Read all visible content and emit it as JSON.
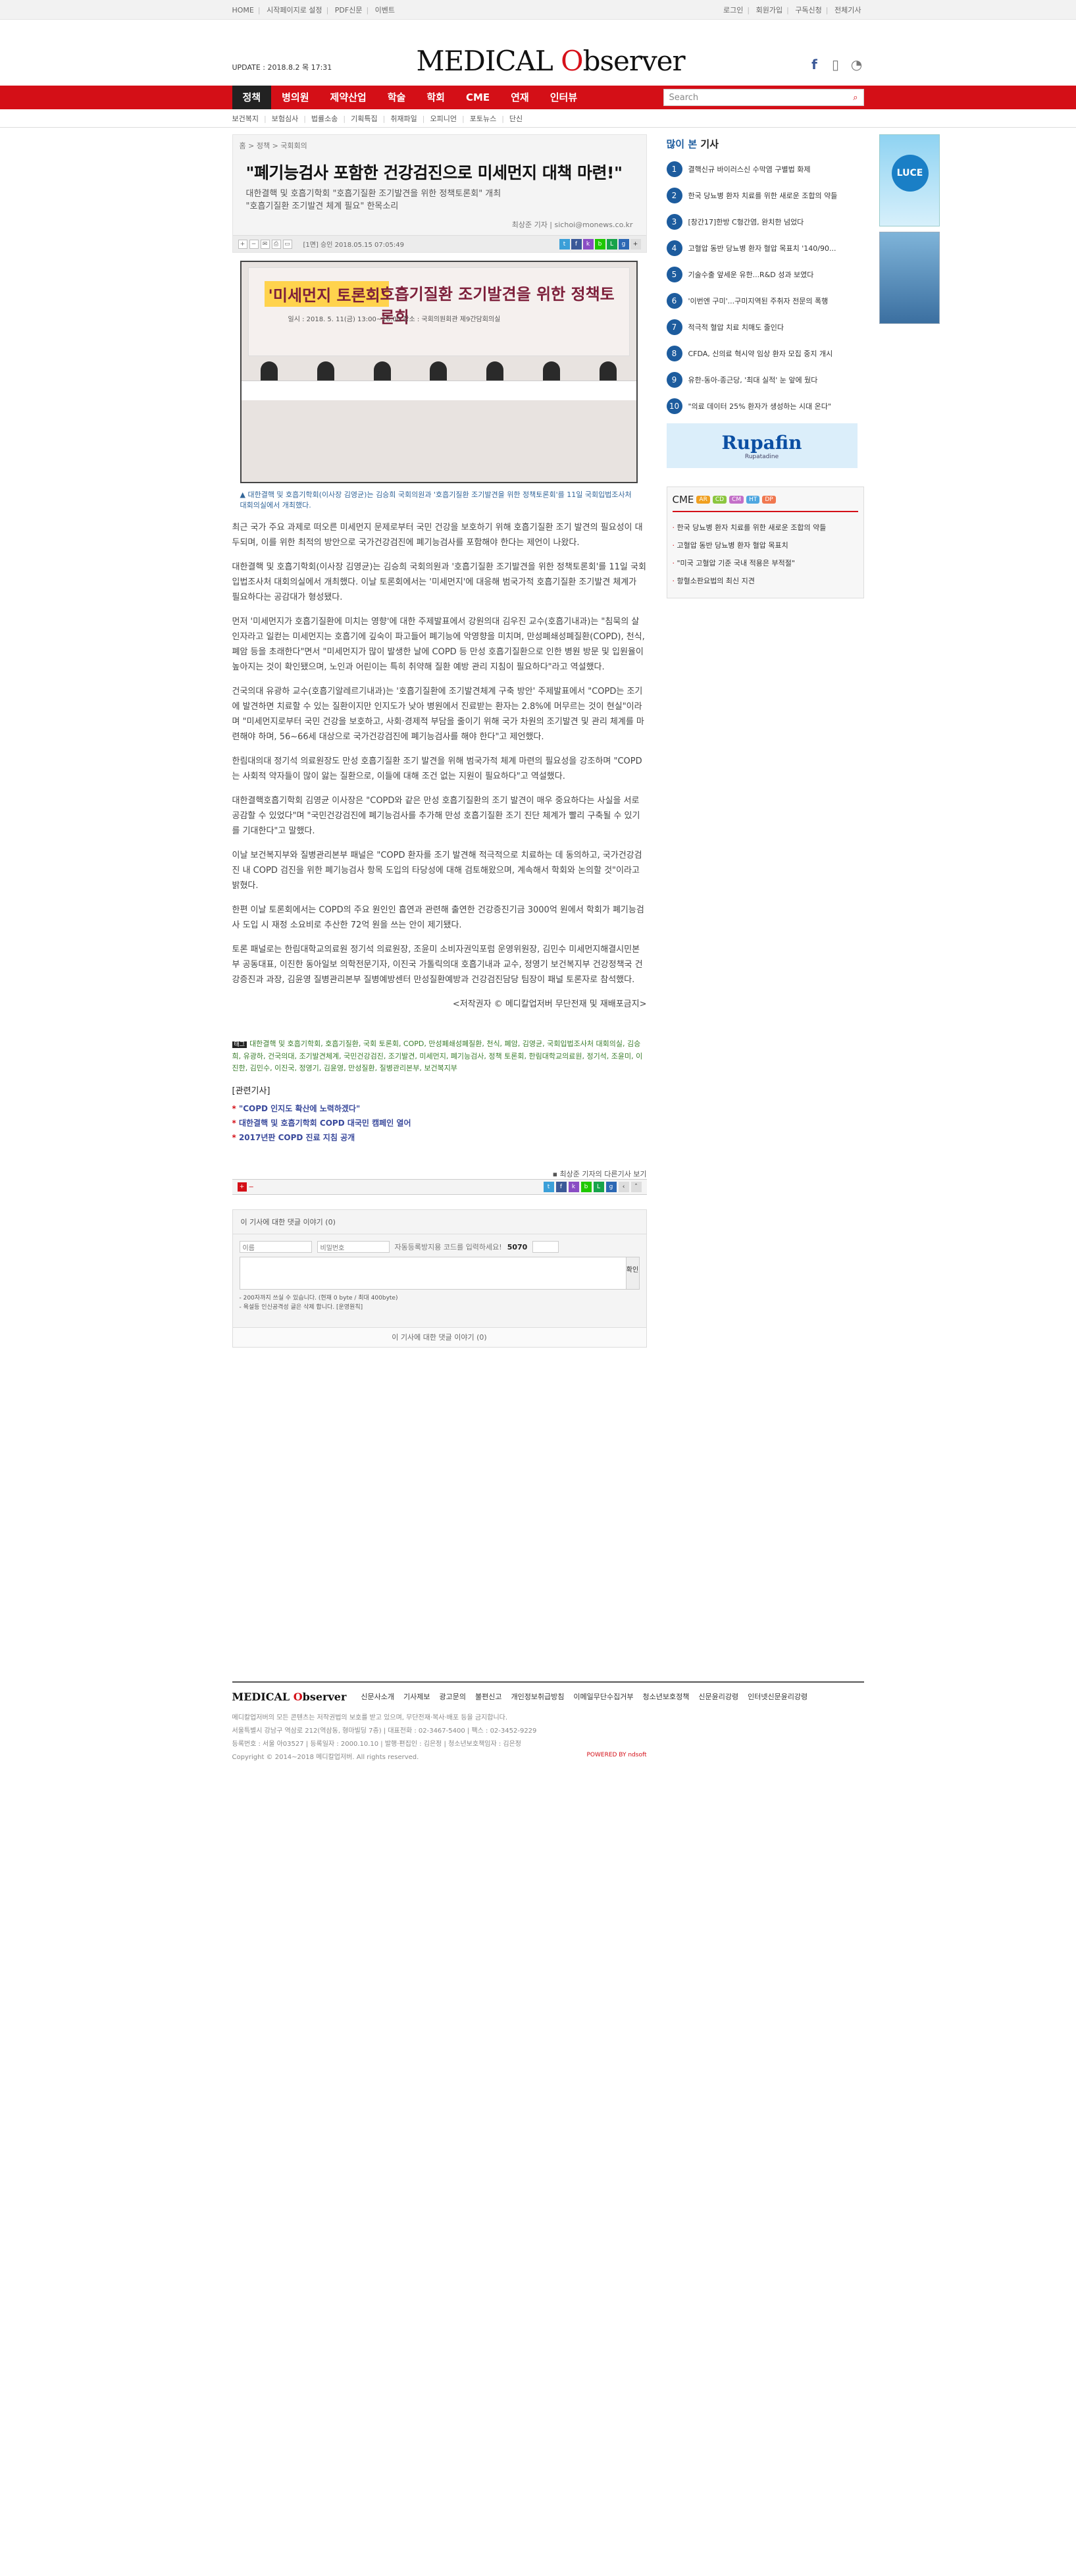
{
  "topbar": {
    "left": [
      "HOME",
      "시작페이지로 설정",
      "PDF신문",
      "이벤트"
    ],
    "right": [
      "로그인",
      "회원가입",
      "구독신청",
      "전체기사"
    ]
  },
  "header": {
    "update": "UPDATE : 2018.8.2 목 17:31",
    "logo_a": "MEDICAL ",
    "logo_o": "O",
    "logo_b": "bserver"
  },
  "nav": {
    "items": [
      "정책",
      "병의원",
      "제약산업",
      "학술",
      "학회",
      "CME",
      "연재",
      "인터뷰"
    ],
    "search_placeholder": "Search"
  },
  "subnav": [
    "보건복지",
    "보험심사",
    "법률소송",
    "기획특집",
    "취재파일",
    "오피니언",
    "포토뉴스",
    "단신"
  ],
  "article": {
    "crumb": "홈 > 정책 > 국회회의",
    "title": "\"폐기능검사 포함한 건강검진으로 미세먼지 대책 마련!\"",
    "subtitle1": "대한결핵 및 호흡기학회 \"호흡기질환 조기발견을 위한 정책토론회\" 개최",
    "subtitle2": "\"호흡기질환 조기발견 체계 필요\" 한목소리",
    "byline": "최상준 기자  |  sichoi@monews.co.kr",
    "date": "[1면] 승인 2018.05.15 07:05:49",
    "photo_banner_hl": "'미세먼지 토론회'",
    "photo_banner_rest": "호흡기질환 조기발견을 위한 정책토론회",
    "photo_info": "일시 : 2018. 5. 11(금) 13:00~16:00   장소 : 국회의원회관 제9간담회의실",
    "caption": "▲ 대한결핵 및 호흡기학회(이사장 김영균)는 김승희 국회의원과 '호흡기질환 조기발견을 위한 정책토론회'를 11일 국회입법조사처 대회의실에서 개최했다.",
    "paragraphs": [
      "최근 국가 주요 과제로 떠오른 미세먼지 문제로부터 국민 건강을 보호하기 위해 호흡기질환 조기 발견의 필요성이 대두되며, 이를 위한 최적의 방안으로 국가건강검진에 폐기능검사를 포함해야 한다는 제언이 나왔다.",
      "대한결핵 및 호흡기학회(이사장 김영균)는 김승희 국회의원과 '호흡기질환 조기발견을 위한 정책토론회'를 11일 국회입법조사처 대회의실에서 개최했다. 이날 토론회에서는 '미세먼지'에 대응해 범국가적 호흡기질환 조기발견 체계가 필요하다는 공감대가 형성됐다.",
      "먼저 '미세먼지가 호흡기질환에 미치는 영향'에 대한 주제발표에서 강원의대 김우진 교수(호흡기내과)는 \"침묵의 살인자라고 일컫는 미세먼지는 호흡기에 깊숙이 파고들어 폐기능에 악영향을 미치며, 만성폐쇄성폐질환(COPD), 천식, 폐암 등을 초래한다\"면서 \"미세먼지가 많이 발생한 날에 COPD 등 만성 호흡기질환으로 인한 병원 방문 및 입원율이 높아지는 것이 확인됐으며, 노인과 어린이는 특히 취약해 질환 예방 관리 지침이 필요하다\"라고 역설했다.",
      "건국의대 유광하 교수(호흡기알레르기내과)는 '호흡기질환에 조기발견체계 구축 방안' 주제발표에서 \"COPD는 조기에 발견하면 치료할 수 있는 질환이지만 인지도가 낮아 병원에서 진료받는 환자는 2.8%에 머무르는 것이 현실\"이라며 \"미세먼지로부터 국민 건강을 보호하고, 사회·경제적 부담을 줄이기 위해 국가 차원의 조기발견 및 관리 체계를 마련해야 하며, 56~66세 대상으로 국가건강검진에 폐기능검사를 해야 한다\"고 제언했다.",
      "한림대의대 정기석 의료원장도 만성 호흡기질환 조기 발견을 위해 범국가적 체계 마련의 필요성을 강조하며 \"COPD는 사회적 약자들이 많이 앓는 질환으로, 이들에 대해 조건 없는 지원이 필요하다\"고 역설했다.",
      "대한결핵호흡기학회 김영균 이사장은 \"COPD와 같은 만성 호흡기질환의 조기 발견이 매우 중요하다는 사실을 서로 공감할 수 있었다\"며 \"국민건강검진에 폐기능검사를 추가해 만성 호흡기질환 조기 진단 체계가 빨리 구축될 수 있기를 기대한다\"고 말했다.",
      "이날 보건복지부와 질병관리본부 패널은 \"COPD 환자를 조기 발견해 적극적으로 치료하는 데 동의하고, 국가건강검진 내 COPD 검진을 위한 폐기능검사 항목 도입의 타당성에 대해 검토해왔으며, 계속해서 학회와 논의할 것\"이라고 밝혔다.",
      "한편 이날 토론회에서는 COPD의 주요 원인인 흡연과 관련해 출연한 건강증진기금 3000억 원에서 학회가 폐기능검사 도입 시 재정 소요비로 추산한 72억 원을 쓰는 안이 제기됐다.",
      "토론 패널로는 한림대학교의료원 정기석 의료원장, 조윤미 소비자권익포럼 운영위원장, 김민수 미세먼지해결시민본부 공동대표, 이진한 동아일보 의학전문기자, 이진국 가톨릭의대 호흡기내과 교수, 정영기 보건복지부 건강정책국 건강증진과 과장, 김윤영 질병관리본부 질병예방센터 만성질환예방과 건강검진담당 팀장이 패널 토론자로 참석했다."
    ],
    "copyright": "<저작권자 © 메디칼업저버 무단전재 및 재배포금지>",
    "tags_label": "태그",
    "tags": "대한결핵 및 호흡기학회, 호흡기질환, 국회 토론회, COPD, 만성폐쇄성폐질환, 천식, 폐암, 김영균, 국회입법조사처 대회의실, 김승희, 유광하, 건국의대, 조기발견체계, 국민건강검진, 조기발견, 미세먼지, 폐기능검사, 정책 토론회, 한림대학교의료원, 정기석, 조윤미, 이진한, 김민수, 이진국, 정영기, 김윤영, 만성질환, 질병관리본부, 보건복지부",
    "related_h": "[관련기사]",
    "related": [
      "\"COPD 인지도 확산에 노력하겠다\"",
      "대한결핵 및 호흡기학회 COPD 대국민 캠페인 열어",
      "2017년판 COPD 진료 지침 공개"
    ],
    "more": "▪ 최상준 기자의 다른기사 보기",
    "comments": {
      "head": "이 기사에 대한 댓글 이야기 (0)",
      "name": "이름",
      "pw": "비밀번호",
      "captcha_label": "자동등록방지용 코드를 입력하세요!",
      "captcha": "5070",
      "submit": "확인",
      "note1": "- 200자까지 쓰실 수 있습니다. (현재 0 byte / 최대 400byte)",
      "note2": "- 욕설등 인신공격성 글은 삭제 합니다. [운영원칙]",
      "foot": "이 기사에 대한 댓글 이야기 (0)"
    }
  },
  "side": {
    "popular_title_a": "많이 본 ",
    "popular_title_b": "기사",
    "popular": [
      "결핵신규 바이러스신 수막염 구별법 화제",
      "한국 당뇨병 환자 치료를 위한 새로운 조합의 약들",
      "[창간17]한방 C형간염, 완치한 넘었다",
      "고혈압 동반 당뇨병 환자 혈압 목표치 '140/90...",
      "기술수출 앞세운 유한...R&D 성과 보였다",
      "'이번엔 구미'...구미지역된 주취자 전문의 폭행",
      "적극적 혈압 치료 치매도 줄인다",
      "CFDA, 신의료 혁시약 임상 환자 모집 중지 개시",
      "유한-동아-종근당, '최대 실적' 눈 앞에 뒀다",
      "\"의료 데이터 25% 환자가 생성하는 시대 온다\""
    ],
    "rupafin": "Rupafin",
    "rupafin_sub": "Rupatadine",
    "cme_title": "CME",
    "cme_tabs": [
      "AR",
      "CD",
      "CM",
      "HT",
      "DP"
    ],
    "cme_items": [
      "한국 당뇨병 환자 치료를 위한 새로운 조합의 약들",
      "고혈압 동반 당뇨병 환자 혈압 목표치",
      "\"미국 고혈압 기준 국내 적용은 부적절\"",
      "항혈소판요법의 최신 지견"
    ],
    "luce": "LUCE"
  },
  "footer": {
    "links": [
      "신문사소개",
      "기사제보",
      "광고문의",
      "불편신고",
      "개인정보취급방침",
      "이메일무단수집거부",
      "청소년보호정책",
      "신문윤리강령",
      "인터넷신문윤리강령"
    ],
    "info1": "메디칼업저버의 모든 콘텐츠는 저작권법의 보호를 받고 있으며, 무단전재·복사·배포 등을 금지합니다.",
    "info2": "서울특별시 강남구 역삼로 212(역삼동, 형마빌딩 7층)  |  대표전화 : 02-3467-5400  |  팩스 : 02-3452-9229",
    "info3": "등록번호 : 서울 아03527  |  등록일자 : 2000.10.10  |  발행·편집인 : 김은정  |  청소년보호책임자 : 김은정",
    "info4": "Copyright © 2014~2018 메디칼업저버. All rights reserved.",
    "powered": "POWERED BY ndsoft"
  }
}
